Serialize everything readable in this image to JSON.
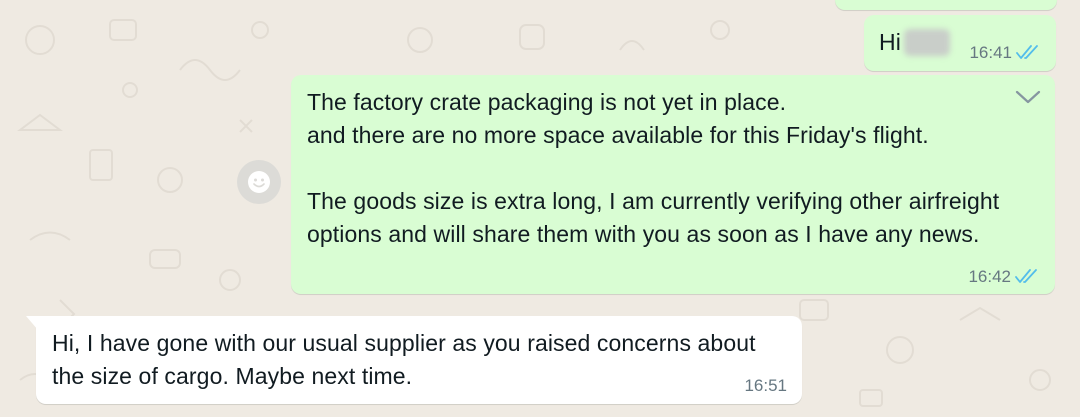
{
  "colors": {
    "chat_background": "#efeae2",
    "outgoing_bubble": "#d9fdd3",
    "incoming_bubble": "#ffffff",
    "read_ticks": "#53bdeb",
    "timestamp": "#667781"
  },
  "messages": [
    {
      "direction": "outgoing",
      "text": "Hi",
      "time": "16:41",
      "status_icon": "double-check-read-icon",
      "redacted_name": true
    },
    {
      "direction": "outgoing",
      "text": "The factory crate packaging is not yet in place.\nand there are no more space available for this Friday's flight.\n\nThe goods size is extra long, I am currently verifying other airfreight options and will share them with you as soon as I have any news.",
      "time": "16:42",
      "status_icon": "double-check-read-icon",
      "menu_icon": "chevron-down-icon"
    },
    {
      "direction": "incoming",
      "text": "Hi, I have gone with our usual supplier as you raised concerns about the size of cargo. Maybe next time.",
      "time": "16:51"
    }
  ],
  "side_action_icon": "smiley-reaction-icon"
}
